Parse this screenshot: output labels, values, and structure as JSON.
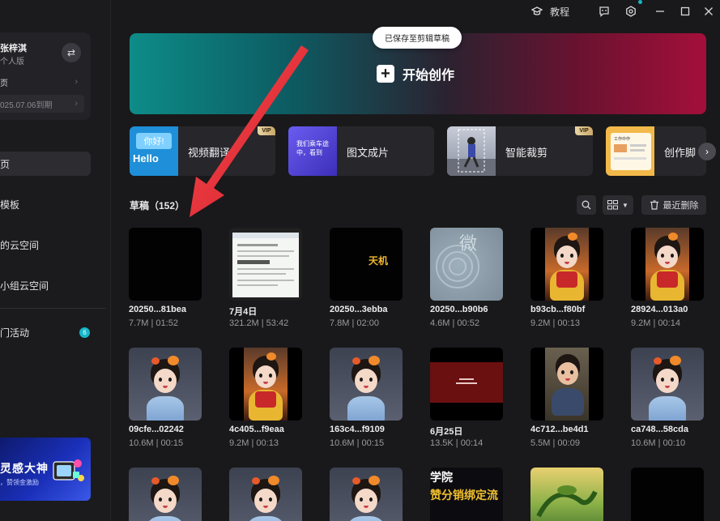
{
  "window": {
    "tutorial_label": "教程"
  },
  "user": {
    "name": "张梓淇",
    "plan": "个人版",
    "row1": "页",
    "row2": "025.07.06到期"
  },
  "sidebar": {
    "items": [
      {
        "label": "页"
      },
      {
        "label": "模板"
      },
      {
        "label": "的云空间"
      },
      {
        "label": "小组云空间"
      },
      {
        "label": "门活动"
      }
    ],
    "activity_badge": "6",
    "promo_title": "灵感大神",
    "promo_sub": "，赞领金激励"
  },
  "hero": {
    "start_label": "开始创作",
    "toast": "已保存至剪辑草稿"
  },
  "features": [
    {
      "label": "视频翻译",
      "vip": "VIP",
      "thumb_text1": "你好!",
      "thumb_text2": "Hello"
    },
    {
      "label": "图文成片",
      "vip": "",
      "thumb_text1": "我们乘车途中，看到"
    },
    {
      "label": "智能裁剪",
      "vip": "VIP"
    },
    {
      "label": "创作脚",
      "vip": "",
      "thumb_text1": "工作中作"
    }
  ],
  "drafts": {
    "title": "草稿（152）",
    "recent_delete": "最近删除",
    "items": [
      {
        "name": "20250...81bea",
        "meta": "7.7M | 01:52",
        "kind": "dark"
      },
      {
        "name": "7月4日",
        "meta": "321.2M | 53:42",
        "kind": "doc"
      },
      {
        "name": "20250...3ebba",
        "meta": "7.8M | 02:00",
        "kind": "tianji",
        "overlay": "天机"
      },
      {
        "name": "20250...b90b6",
        "meta": "4.6M | 00:52",
        "kind": "grey",
        "overlay": "微"
      },
      {
        "name": "b93cb...f80bf",
        "meta": "9.2M | 00:13",
        "kind": "girl-stage"
      },
      {
        "name": "28924...013a0",
        "meta": "9.2M | 00:14",
        "kind": "girl-stage"
      },
      {
        "name": "09cfe...02242",
        "meta": "10.6M | 00:15",
        "kind": "girl-blue"
      },
      {
        "name": "4c405...f9eaa",
        "meta": "9.2M | 00:13",
        "kind": "girl-stage"
      },
      {
        "name": "163c4...f9109",
        "meta": "10.6M | 00:15",
        "kind": "girl-blue"
      },
      {
        "name": "6月25日",
        "meta": "13.5K | 00:14",
        "kind": "red"
      },
      {
        "name": "4c712...be4d1",
        "meta": "5.5M | 00:09",
        "kind": "girl-street"
      },
      {
        "name": "ca748...58cda",
        "meta": "10.6M | 00:10",
        "kind": "girl-blue"
      },
      {
        "name": "",
        "meta": "",
        "kind": "girl-blue"
      },
      {
        "name": "",
        "meta": "",
        "kind": "girl-blue"
      },
      {
        "name": "",
        "meta": "",
        "kind": "girl-blue"
      },
      {
        "name": "",
        "meta": "",
        "kind": "text",
        "overlay": "赞分销绑定流",
        "overlay2": "学院"
      },
      {
        "name": "",
        "meta": "",
        "kind": "nature"
      },
      {
        "name": "",
        "meta": "",
        "kind": "dark"
      }
    ]
  },
  "colors": {
    "accent": "#18b6c9",
    "arrow": "#e8303a",
    "background": "#19191b"
  }
}
